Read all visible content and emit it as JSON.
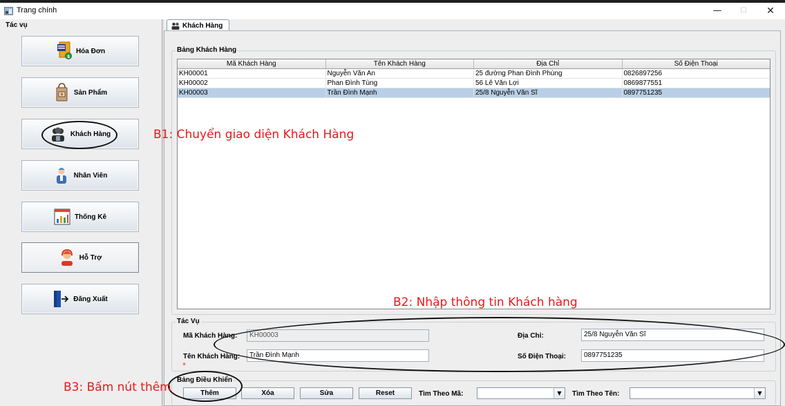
{
  "window": {
    "title": "Trang chính",
    "minimize": "—",
    "maximize": "☐",
    "close": "✕"
  },
  "sidebar": {
    "title": "Tác vụ",
    "items": [
      {
        "label": "Hóa Đơn",
        "icon": "invoice-icon"
      },
      {
        "label": "Sản Phẩm",
        "icon": "product-bag-icon"
      },
      {
        "label": "Khách Hàng",
        "icon": "customers-icon"
      },
      {
        "label": "Nhân Viên",
        "icon": "employee-icon"
      },
      {
        "label": "Thống Kê",
        "icon": "statistics-icon"
      },
      {
        "label": "Hỗ Trợ",
        "icon": "support-agent-icon"
      },
      {
        "label": "Đăng Xuất",
        "icon": "logout-door-icon"
      }
    ]
  },
  "tab": {
    "label": "Khách Hàng",
    "icon": "customers-icon"
  },
  "table": {
    "title": "Bảng Khách Hàng",
    "columns": [
      "Mã Khách Hàng",
      "Tên Khách Hàng",
      "Địa Chỉ",
      "Số Điện Thoại"
    ],
    "rows": [
      [
        "KH00001",
        "Nguyễn Văn An",
        "25 đường Phan Đình Phùng",
        "0826897256"
      ],
      [
        "KH00002",
        "Phan Đình Tùng",
        "56 Lê Văn Lợi",
        "0869877551"
      ],
      [
        "KH00003",
        "Trần Đình Mạnh",
        "25/8 Nguyễn Văn Sĩ",
        "0897751235"
      ]
    ],
    "selected_row": 2
  },
  "form": {
    "title": "Tác Vụ",
    "ma_label": "Mã Khách Hàng:",
    "ma_value": "KH00003",
    "ten_label": "Tên Khách Hàng:",
    "ten_value": "Trần Đình Mạnh",
    "diachi_label": "Địa Chỉ:",
    "diachi_value": "25/8 Nguyễn Văn Sĩ",
    "sdt_label": "Số Điện Thoại:",
    "sdt_value": "0897751235",
    "required_mark": "*"
  },
  "controls": {
    "title": "Bảng Điều Khiển",
    "them": "Thêm",
    "xoa": "Xóa",
    "sua": "Sửa",
    "reset": "Reset",
    "tim_ma_label": "Tìm Theo Mã:",
    "tim_ten_label": "Tìm Theo Tên:"
  },
  "annotations": {
    "b1": "B1: Chuyển giao diện Khách Hàng",
    "b2": "B2: Nhập thông tin Khách hàng",
    "b3": "B3: Bấm nút thêm"
  },
  "colors": {
    "annotation": "#e8181c",
    "selected_row": "#b8cfe5"
  }
}
